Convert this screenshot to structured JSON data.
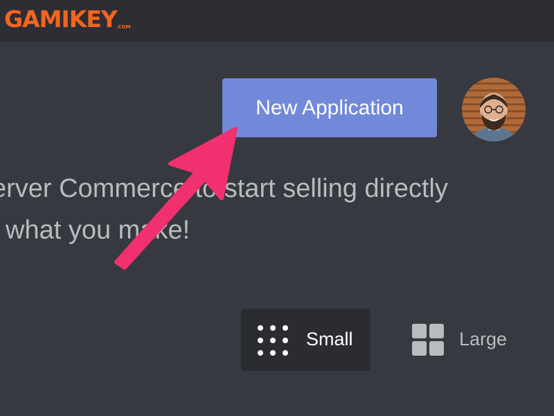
{
  "header": {
    "logo_text": "GAMIKEY",
    "logo_suffix": ".COM"
  },
  "main": {
    "new_application_label": "New Application",
    "promo_line1": "erver Commerce to start selling directly",
    "promo_line2": "what you make!"
  },
  "view_size": {
    "small_label": "Small",
    "large_label": "Large",
    "selected": "Small"
  },
  "colors": {
    "background": "#36393f",
    "topbar": "#2c2e33",
    "button_blurple": "#7289da",
    "annotation_arrow": "#f0306f",
    "logo_orange": "#f26522"
  },
  "icons": {
    "small_view": "dots-grid-icon",
    "large_view": "squares-grid-icon",
    "annotation": "pointer-arrow-icon"
  }
}
